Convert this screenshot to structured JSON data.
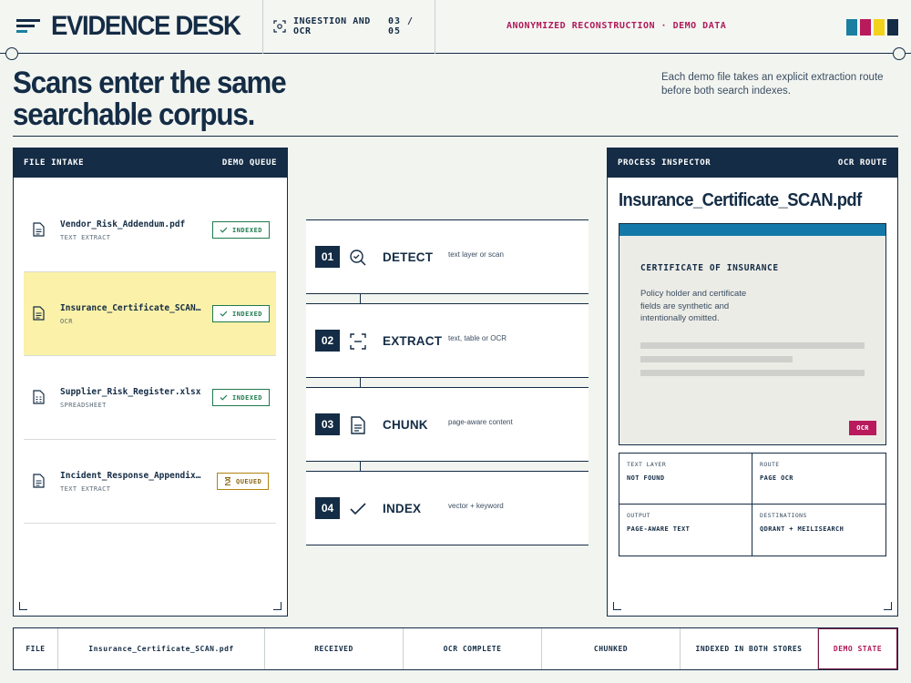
{
  "header": {
    "app_title": "EVIDENCE DESK",
    "step_label": "INGESTION AND OCR",
    "step_count": "03 / 05",
    "banner": "ANONYMIZED RECONSTRUCTION · DEMO DATA",
    "swatches": [
      "#1a7fa0",
      "#b81a5c",
      "#f2d21a",
      "#142c45"
    ]
  },
  "hero": {
    "title": "Scans enter the same searchable corpus.",
    "description": "Each demo file takes an explicit extraction route before both search indexes."
  },
  "intake": {
    "heading": "FILE INTAKE",
    "tag": "DEMO QUEUE",
    "files": [
      {
        "name": "Vendor_Risk_Addendum.pdf",
        "method": "TEXT EXTRACT",
        "status": "INDEXED"
      },
      {
        "name": "Insurance_Certificate_SCAN.pdf",
        "method": "OCR",
        "status": "INDEXED"
      },
      {
        "name": "Supplier_Risk_Register.xlsx",
        "method": "SPREADSHEET",
        "status": "INDEXED"
      },
      {
        "name": "Incident_Response_Appendix.pdf",
        "method": "TEXT EXTRACT",
        "status": "QUEUED"
      }
    ]
  },
  "pipeline": {
    "stages": [
      {
        "num": "01",
        "name": "DETECT",
        "hint": "text layer or scan"
      },
      {
        "num": "02",
        "name": "EXTRACT",
        "hint": "text, table or OCR"
      },
      {
        "num": "03",
        "name": "CHUNK",
        "hint": "page-aware content"
      },
      {
        "num": "04",
        "name": "INDEX",
        "hint": "vector + keyword"
      }
    ]
  },
  "inspector": {
    "heading": "PROCESS INSPECTOR",
    "tag": "OCR ROUTE",
    "file_title": "Insurance_Certificate_SCAN.pdf",
    "doc_heading": "CERTIFICATE OF INSURANCE",
    "doc_body": "Policy holder and certificate fields are synthetic and intentionally omitted.",
    "doc_tag": "OCR",
    "meta": [
      {
        "label": "TEXT LAYER",
        "value": "NOT FOUND"
      },
      {
        "label": "ROUTE",
        "value": "PAGE OCR"
      },
      {
        "label": "OUTPUT",
        "value": "PAGE-AWARE TEXT"
      },
      {
        "label": "DESTINATIONS",
        "value": "QDRANT + MEILISEARCH"
      }
    ]
  },
  "statusbar": {
    "file_label": "FILE",
    "file_value": "Insurance_Certificate_SCAN.pdf",
    "steps": [
      "RECEIVED",
      "OCR COMPLETE",
      "CHUNKED",
      "INDEXED IN BOTH STORES"
    ],
    "state": "DEMO STATE"
  }
}
